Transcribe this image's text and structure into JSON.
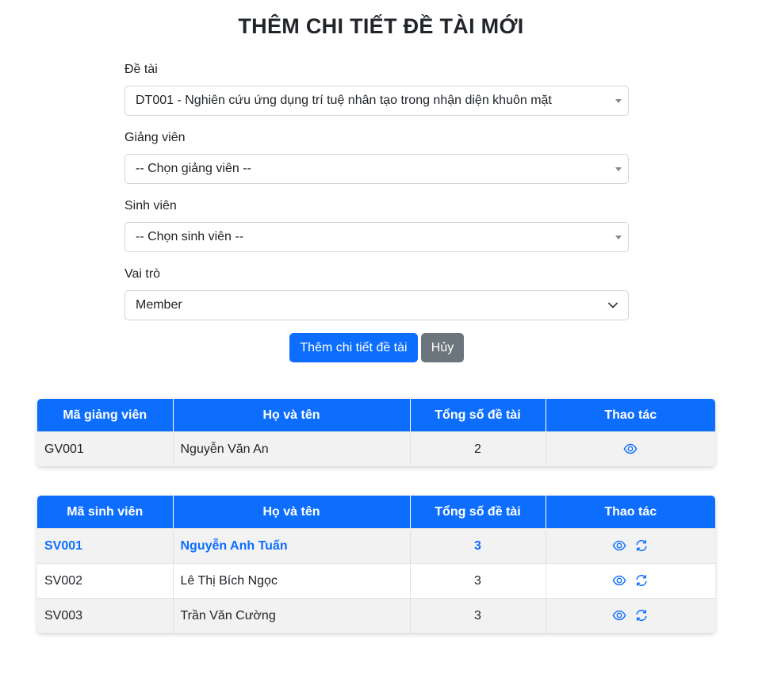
{
  "page_title": "THÊM CHI TIẾT ĐỀ TÀI MỚI",
  "form": {
    "topic_label": "Đề tài",
    "topic_value": "DT001 - Nghiên cứu ứng dụng trí tuệ nhân tạo trong nhận diện khuôn mặt",
    "lecturer_label": "Giảng viên",
    "lecturer_value": "-- Chọn giảng viên --",
    "student_label": "Sinh viên",
    "student_value": "-- Chọn sinh viên --",
    "role_label": "Vai trò",
    "role_value": "Member",
    "submit_label": "Thêm chi tiết đề tài",
    "cancel_label": "Hủy"
  },
  "lecturer_table": {
    "headers": [
      "Mã giảng viên",
      "Họ và tên",
      "Tổng số đề tài",
      "Thao tác"
    ],
    "rows": [
      {
        "code": "GV001",
        "name": "Nguyễn Văn An",
        "total": "2"
      }
    ]
  },
  "student_table": {
    "headers": [
      "Mã sinh viên",
      "Họ và tên",
      "Tổng số đề tài",
      "Thao tác"
    ],
    "rows": [
      {
        "code": "SV001",
        "name": "Nguyễn Anh Tuấn",
        "total": "3"
      },
      {
        "code": "SV002",
        "name": "Lê Thị Bích Ngọc",
        "total": "3"
      },
      {
        "code": "SV003",
        "name": "Trần Văn Cường",
        "total": "3"
      }
    ]
  },
  "colors": {
    "primary": "#0d6efd",
    "secondary": "#6c757d",
    "row_alt": "#f2f2f2"
  },
  "icons": {
    "view": "eye-icon",
    "swap": "refresh-icon",
    "select": "caret-down-icon",
    "role_select": "chevron-down-icon"
  }
}
